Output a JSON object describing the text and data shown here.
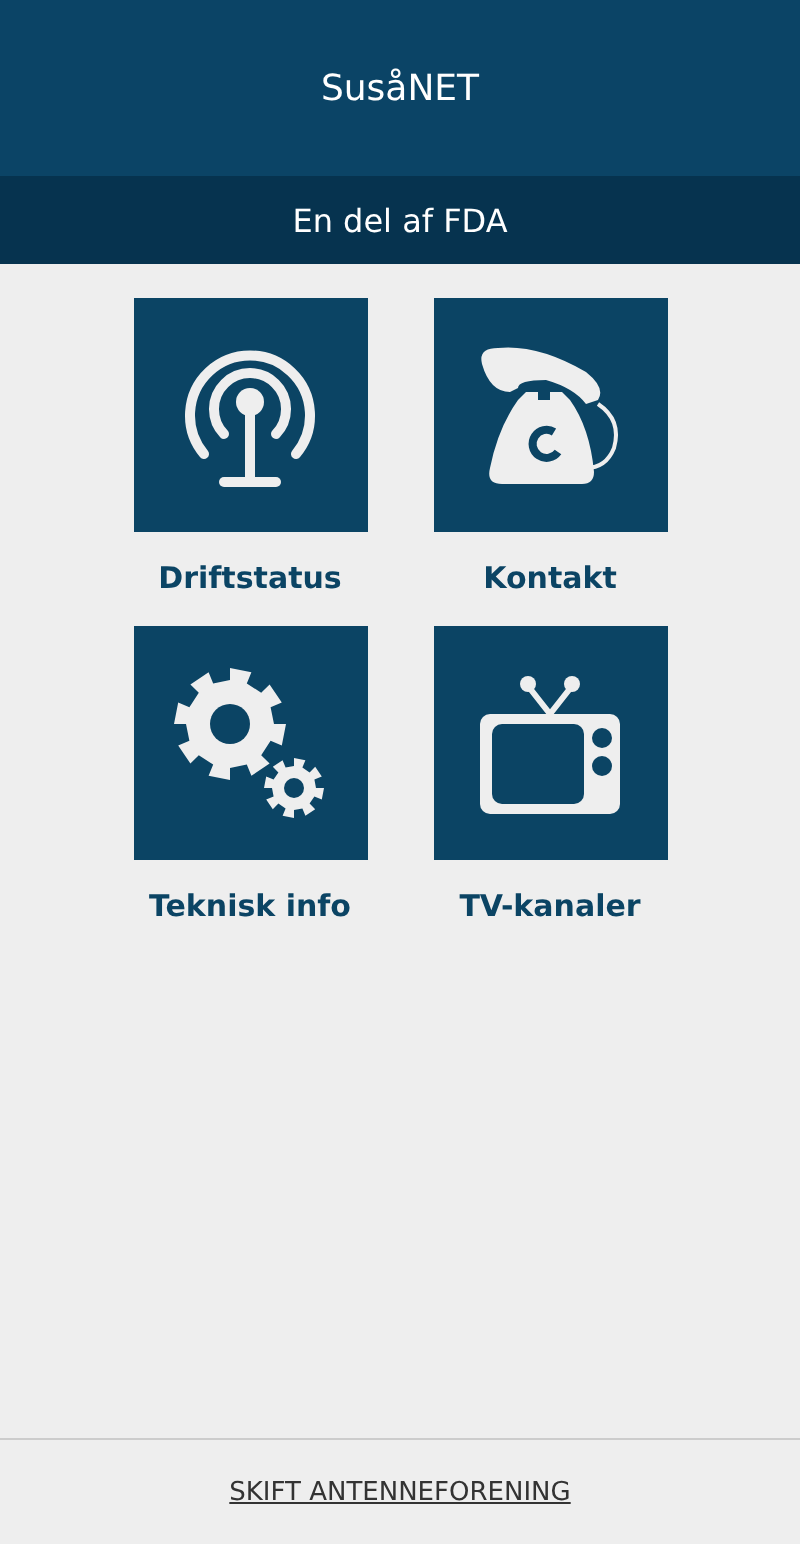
{
  "header": {
    "title": "SusåNET",
    "subtitle": "En del af FDA"
  },
  "tiles": [
    {
      "kind": "antenna",
      "label": "Driftstatus"
    },
    {
      "kind": "phone",
      "label": "Kontakt"
    },
    {
      "kind": "gears",
      "label": "Teknisk info"
    },
    {
      "kind": "tv",
      "label": "TV-kanaler"
    }
  ],
  "footer": {
    "link": "SKIFT ANTENNEFORENING"
  }
}
